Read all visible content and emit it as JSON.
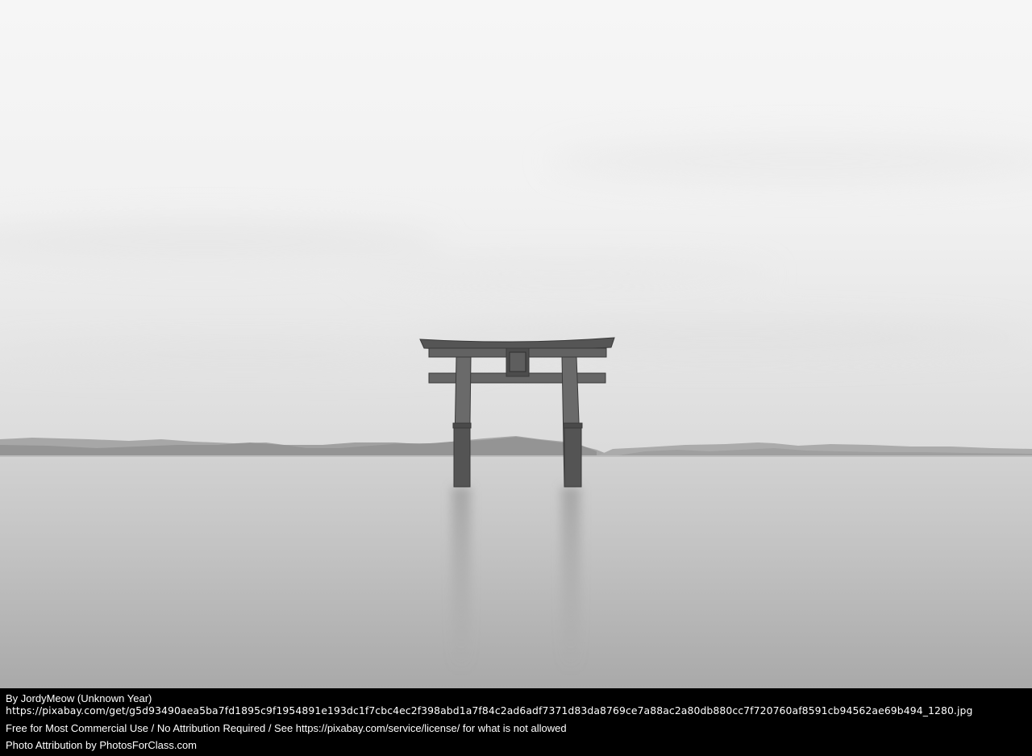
{
  "photo": {
    "subject": "torii-gate-in-lake"
  },
  "caption": {
    "author": "By JordyMeow (Unknown Year)",
    "source_url": "https://pixabay.com/get/g5d93490aea5ba7fd1895c9f1954891e193dc1f7cbc4ec2f398abd1a7f84c2ad6adf7371d83da8769ce7a88ac2a80db880cc7f720760af8591cb94562ae69b494_1280.jpg",
    "license": "Free for Most Commercial Use / No Attribution Required / See https://pixabay.com/service/license/ for what is not allowed",
    "attribution": "Photo Attribution by PhotosForClass.com"
  },
  "colors": {
    "caption_bg": "#000000",
    "caption_text": "#ffffff"
  }
}
